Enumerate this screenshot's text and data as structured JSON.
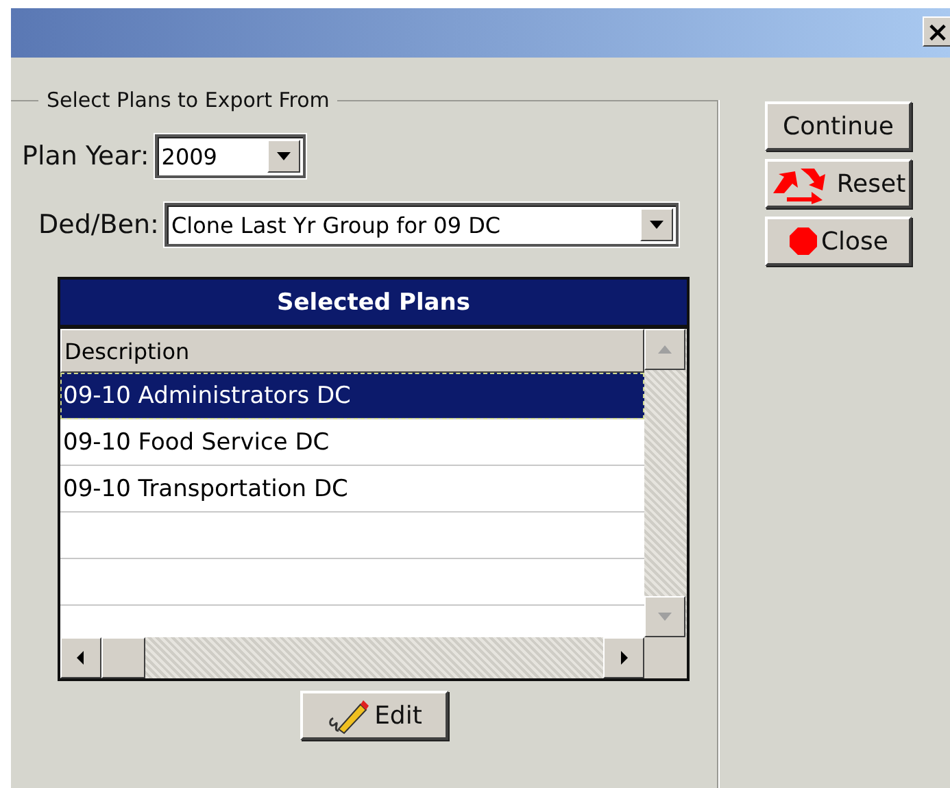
{
  "window": {
    "close_label": "×"
  },
  "group": {
    "legend": "Select Plans to Export From"
  },
  "plan_year": {
    "label": "Plan Year:",
    "value": "2009"
  },
  "ded_ben": {
    "label": "Ded/Ben:",
    "value": "Clone Last Yr Group for 09 DC"
  },
  "grid": {
    "title": "Selected Plans",
    "columns": [
      "Description"
    ],
    "rows": [
      {
        "description": "09-10 Administrators DC",
        "selected": true
      },
      {
        "description": "09-10 Food Service DC",
        "selected": false
      },
      {
        "description": "09-10 Transportation DC",
        "selected": false
      }
    ],
    "empty_rows": [
      "",
      ""
    ]
  },
  "edit_button": {
    "label": "Edit"
  },
  "buttons": [
    {
      "kind": "plain",
      "label": "Continue"
    },
    {
      "kind": "recycle",
      "label": "Reset"
    },
    {
      "kind": "stop",
      "label": "Close"
    }
  ]
}
